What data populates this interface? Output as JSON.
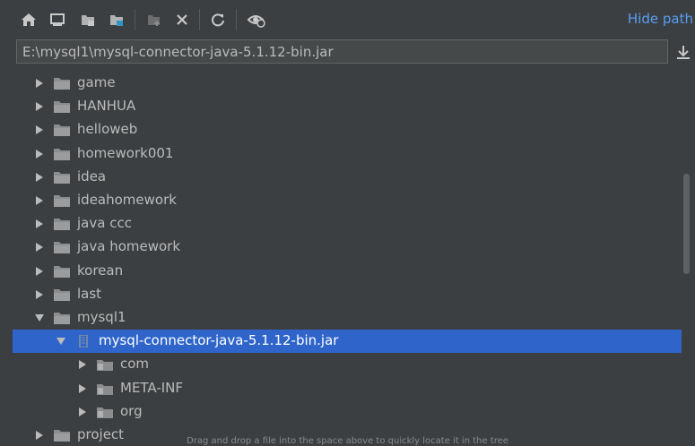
{
  "toolbar": {
    "buttons": [
      {
        "icon": "home-icon"
      },
      {
        "icon": "desktop-icon"
      },
      {
        "icon": "project-folder-icon"
      },
      {
        "icon": "module-folder-icon"
      },
      {
        "icon": "new-folder-icon"
      },
      {
        "icon": "delete-icon"
      },
      {
        "icon": "refresh-icon"
      },
      {
        "icon": "show-hidden-icon"
      }
    ],
    "hide_path_label": "Hide path"
  },
  "path": {
    "value": "E:\\mysql1\\mysql-connector-java-5.1.12-bin.jar"
  },
  "tree": {
    "rows": [
      {
        "label": "game",
        "expanded": false,
        "type": "folder"
      },
      {
        "label": "HANHUA",
        "expanded": false,
        "type": "folder"
      },
      {
        "label": "helloweb",
        "expanded": false,
        "type": "folder"
      },
      {
        "label": "homework001",
        "expanded": false,
        "type": "folder"
      },
      {
        "label": "idea",
        "expanded": false,
        "type": "folder"
      },
      {
        "label": "ideahomework",
        "expanded": false,
        "type": "folder"
      },
      {
        "label": "java ccc",
        "expanded": false,
        "type": "folder"
      },
      {
        "label": "java homework",
        "expanded": false,
        "type": "folder"
      },
      {
        "label": "korean",
        "expanded": false,
        "type": "folder"
      },
      {
        "label": "last",
        "expanded": false,
        "type": "folder"
      },
      {
        "label": "mysql1",
        "expanded": true,
        "type": "folder"
      },
      {
        "label": "mysql-connector-java-5.1.12-bin.jar",
        "expanded": true,
        "type": "jar",
        "selected": true
      },
      {
        "label": "com",
        "expanded": false,
        "type": "package"
      },
      {
        "label": "META-INF",
        "expanded": false,
        "type": "package"
      },
      {
        "label": "org",
        "expanded": false,
        "type": "package"
      },
      {
        "label": "project",
        "expanded": false,
        "type": "folder"
      }
    ]
  },
  "footer": {
    "hint": "Drag and drop a file into the space above to quickly locate it in the tree"
  },
  "colors": {
    "background": "#3c3f41",
    "selection": "#2f65ca",
    "link": "#589df6",
    "text": "#bbbbbb"
  }
}
